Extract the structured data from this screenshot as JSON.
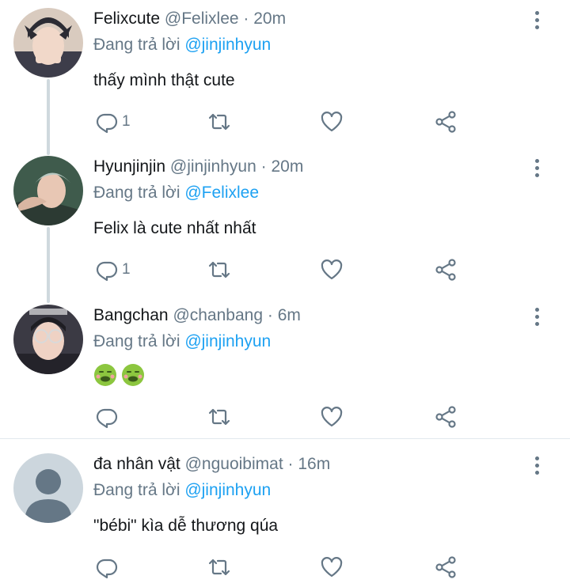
{
  "tweets": [
    {
      "name": "Felixcute",
      "handle": "@Felixlee",
      "sep": "·",
      "time": "20m",
      "replying_prefix": "Đang trả lời",
      "replying_to": "@jinjinhyun",
      "text": "thấy mình thật cute",
      "reply_count": "1"
    },
    {
      "name": "Hyunjinjin",
      "handle": "@jinjinhyun",
      "sep": "·",
      "time": "20m",
      "replying_prefix": "Đang trả lời",
      "replying_to": "@Felixlee",
      "text": "Felix là cute nhất nhất",
      "reply_count": "1"
    },
    {
      "name": "Bangchan",
      "handle": "@chanbang",
      "sep": "·",
      "time": "6m",
      "replying_prefix": "Đang trả lời",
      "replying_to": "@jinjinhyun",
      "text": "",
      "emojis": [
        "nauseated-face-emoji",
        "nauseated-face-emoji"
      ],
      "reply_count": ""
    },
    {
      "name": "đa nhân vật",
      "handle": "@nguoibimat",
      "sep": "·",
      "time": "16m",
      "replying_prefix": "Đang trả lời",
      "replying_to": "@jinjinhyun",
      "text": "\"bébi\" kìa dễ thương qúa",
      "reply_count": ""
    }
  ],
  "icons": {
    "reply": "reply-icon",
    "retweet": "retweet-icon",
    "like": "heart-icon",
    "share": "share-icon",
    "more": "more-vertical-icon"
  },
  "colors": {
    "text": "#14171a",
    "secondary": "#657786",
    "link": "#1da1f2",
    "thread_line": "#cfd9de",
    "divider": "#e1e8ed"
  }
}
